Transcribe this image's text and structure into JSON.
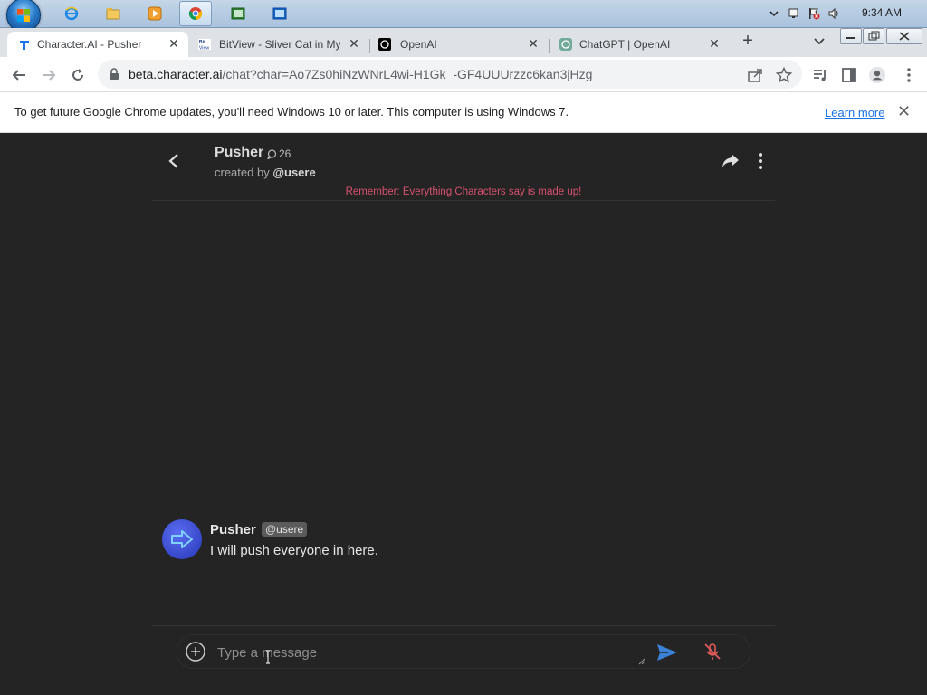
{
  "taskbar": {
    "clock": "9:34 AM",
    "pinned": [
      "internet-explorer-icon",
      "file-explorer-icon",
      "media-player-icon",
      "chrome-icon",
      "app-icon-1",
      "app-icon-2"
    ]
  },
  "tabs": [
    {
      "label": "Character.AI - Pusher",
      "active": true
    },
    {
      "label": "BitView - Sliver Cat in My",
      "active": false
    },
    {
      "label": "OpenAI",
      "active": false
    },
    {
      "label": "ChatGPT | OpenAI",
      "active": false
    }
  ],
  "omnibox": {
    "host": "beta.character.ai",
    "path": "/chat?char=Ao7Zs0hiNzWNrL4wi-H1Gk_-GF4UUUrzzc6kan3jHzg"
  },
  "infobar": {
    "message": "To get future Google Chrome updates, you'll need Windows 10 or later. This computer is using Windows 7.",
    "link": "Learn more"
  },
  "chat": {
    "character_name": "Pusher",
    "chat_count": "26",
    "created_prefix": "created by",
    "creator": "@usere",
    "disclaimer": "Remember: Everything Characters say is made up!",
    "messages": [
      {
        "name": "Pusher",
        "tag": "@usere",
        "text": "I will push everyone in here."
      }
    ],
    "input_placeholder": "Type a message"
  },
  "colors": {
    "page_bg": "#242424",
    "disclaimer": "#d8516d",
    "send": "#3b82d6",
    "mic_muted": "#e05a5a",
    "avatar": "#3a4ad8"
  }
}
